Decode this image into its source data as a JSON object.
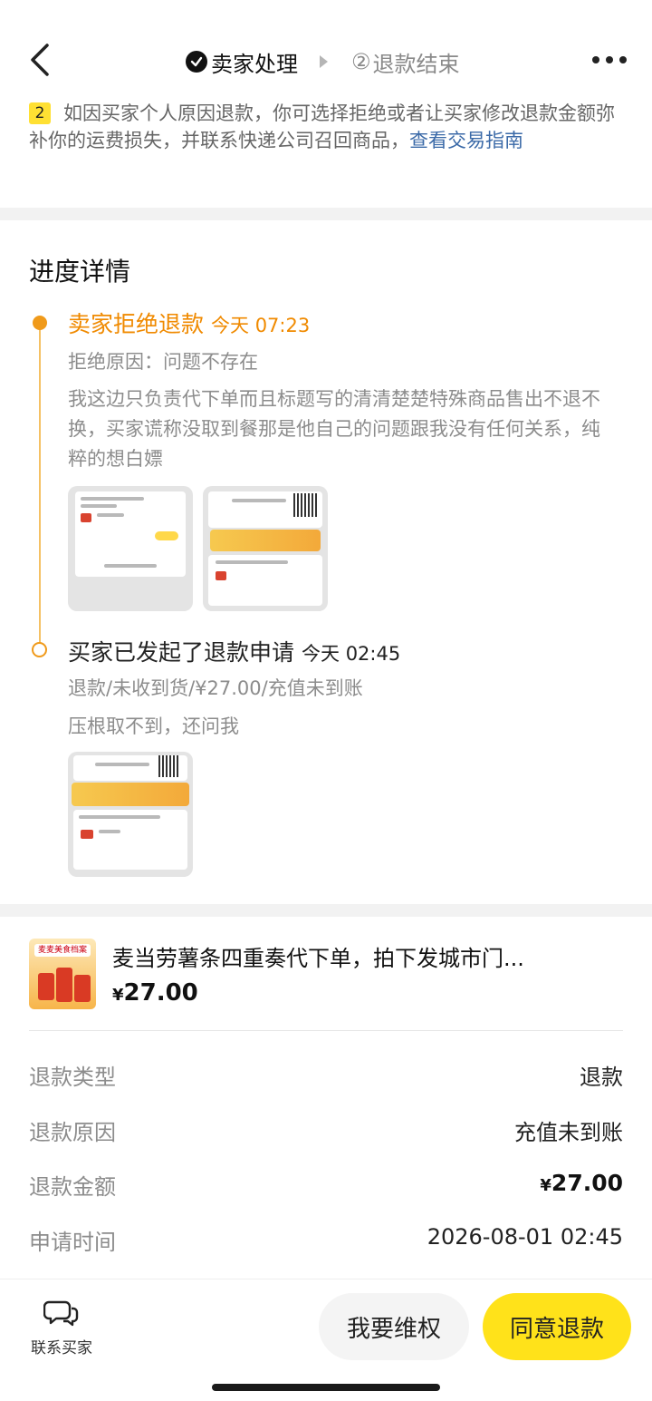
{
  "header": {
    "step1_label": "卖家处理",
    "step2_number": "②",
    "step2_label": "退款结束"
  },
  "tip": {
    "number": "2",
    "text": "如因买家个人原因退款，你可选择拒绝或者让买家修改退款金额弥补你的运费损失，并联系快递公司召回商品，",
    "link": "查看交易指南"
  },
  "progress": {
    "title": "进度详情",
    "events": [
      {
        "title": "卖家拒绝退款",
        "time": "今天 07:23",
        "reason": "拒绝原因：问题不存在",
        "description": "我这边只负责代下单而且标题写的清清楚楚特殊商品售出不退不换，买家谎称没取到餐那是他自己的问题跟我没有任何关系，纯粹的想白嫖"
      },
      {
        "title": "买家已发起了退款申请",
        "time": "今天 02:45",
        "reason": "退款/未收到货/¥27.00/充值未到账",
        "description": "压根取不到，还问我"
      }
    ]
  },
  "product": {
    "image_label": "麦麦美食档案",
    "title": "麦当劳薯条四重奏代下单，拍下发城市门...",
    "price_symbol": "¥",
    "price": "27.00"
  },
  "details": [
    {
      "label": "退款类型",
      "value": "退款"
    },
    {
      "label": "退款原因",
      "value": "充值未到账"
    },
    {
      "label": "退款金额",
      "value": "¥27.00"
    },
    {
      "label": "申请时间",
      "value": "2026-08-01 02:45"
    }
  ],
  "amount_parts": {
    "symbol": "¥",
    "value": "27.00"
  },
  "bottom": {
    "contact_label": "联系买家",
    "rights_button": "我要维权",
    "agree_button": "同意退款"
  },
  "colors": {
    "accent_orange": "#f08a00",
    "primary_yellow": "#ffe21a",
    "link_blue": "#3b6aa8"
  }
}
